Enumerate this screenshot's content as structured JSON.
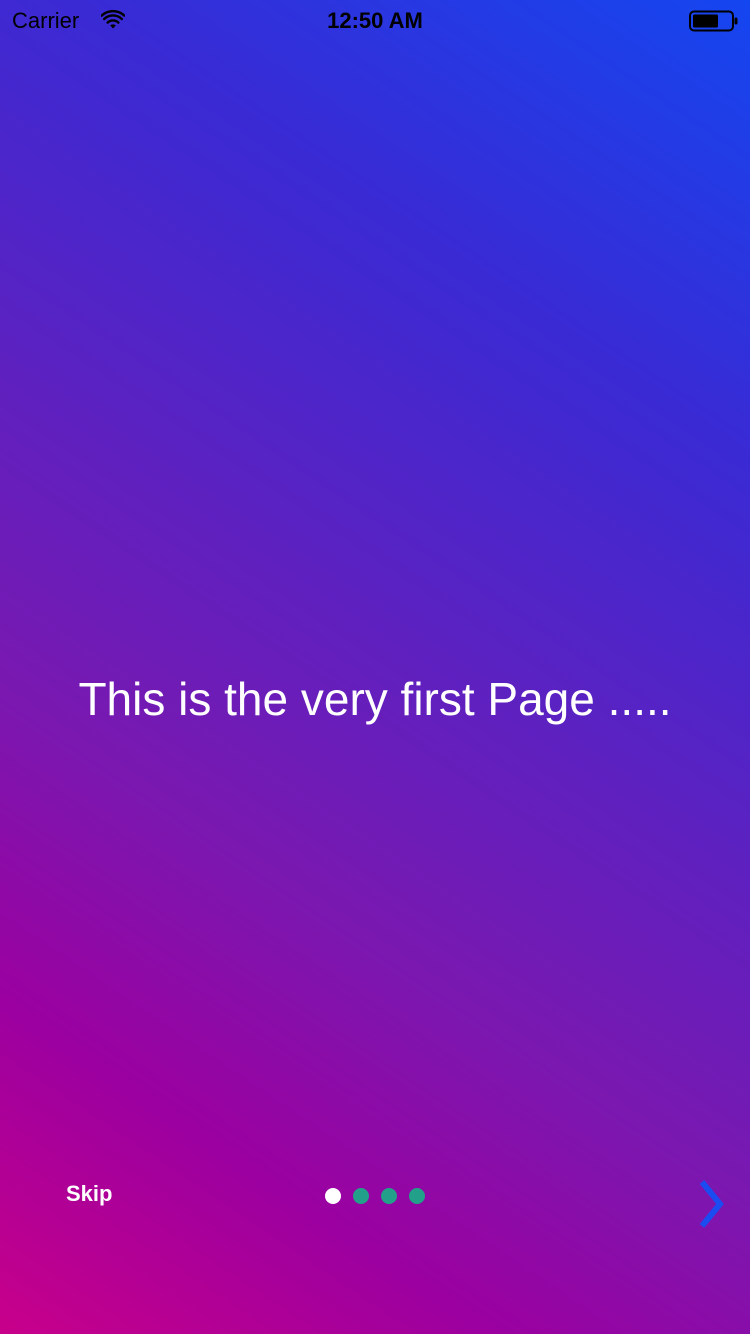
{
  "status_bar": {
    "carrier": "Carrier",
    "time": "12:50 AM",
    "icons": [
      "wifi-icon",
      "battery-icon"
    ]
  },
  "main": {
    "headline": "This is the very first Page ....."
  },
  "controls": {
    "skip_label": "Skip",
    "next_icon": "chevron-right-icon",
    "page_indicator": {
      "total_pages": 4,
      "current_page": 1
    }
  },
  "colors": {
    "gradient_top_right": "#1446f0",
    "gradient_bottom_left": "#c8008a",
    "dot_active": "#ffffff",
    "dot_inactive": "#22a08a",
    "next_button": "#1a4cf2",
    "text": "#ffffff"
  }
}
